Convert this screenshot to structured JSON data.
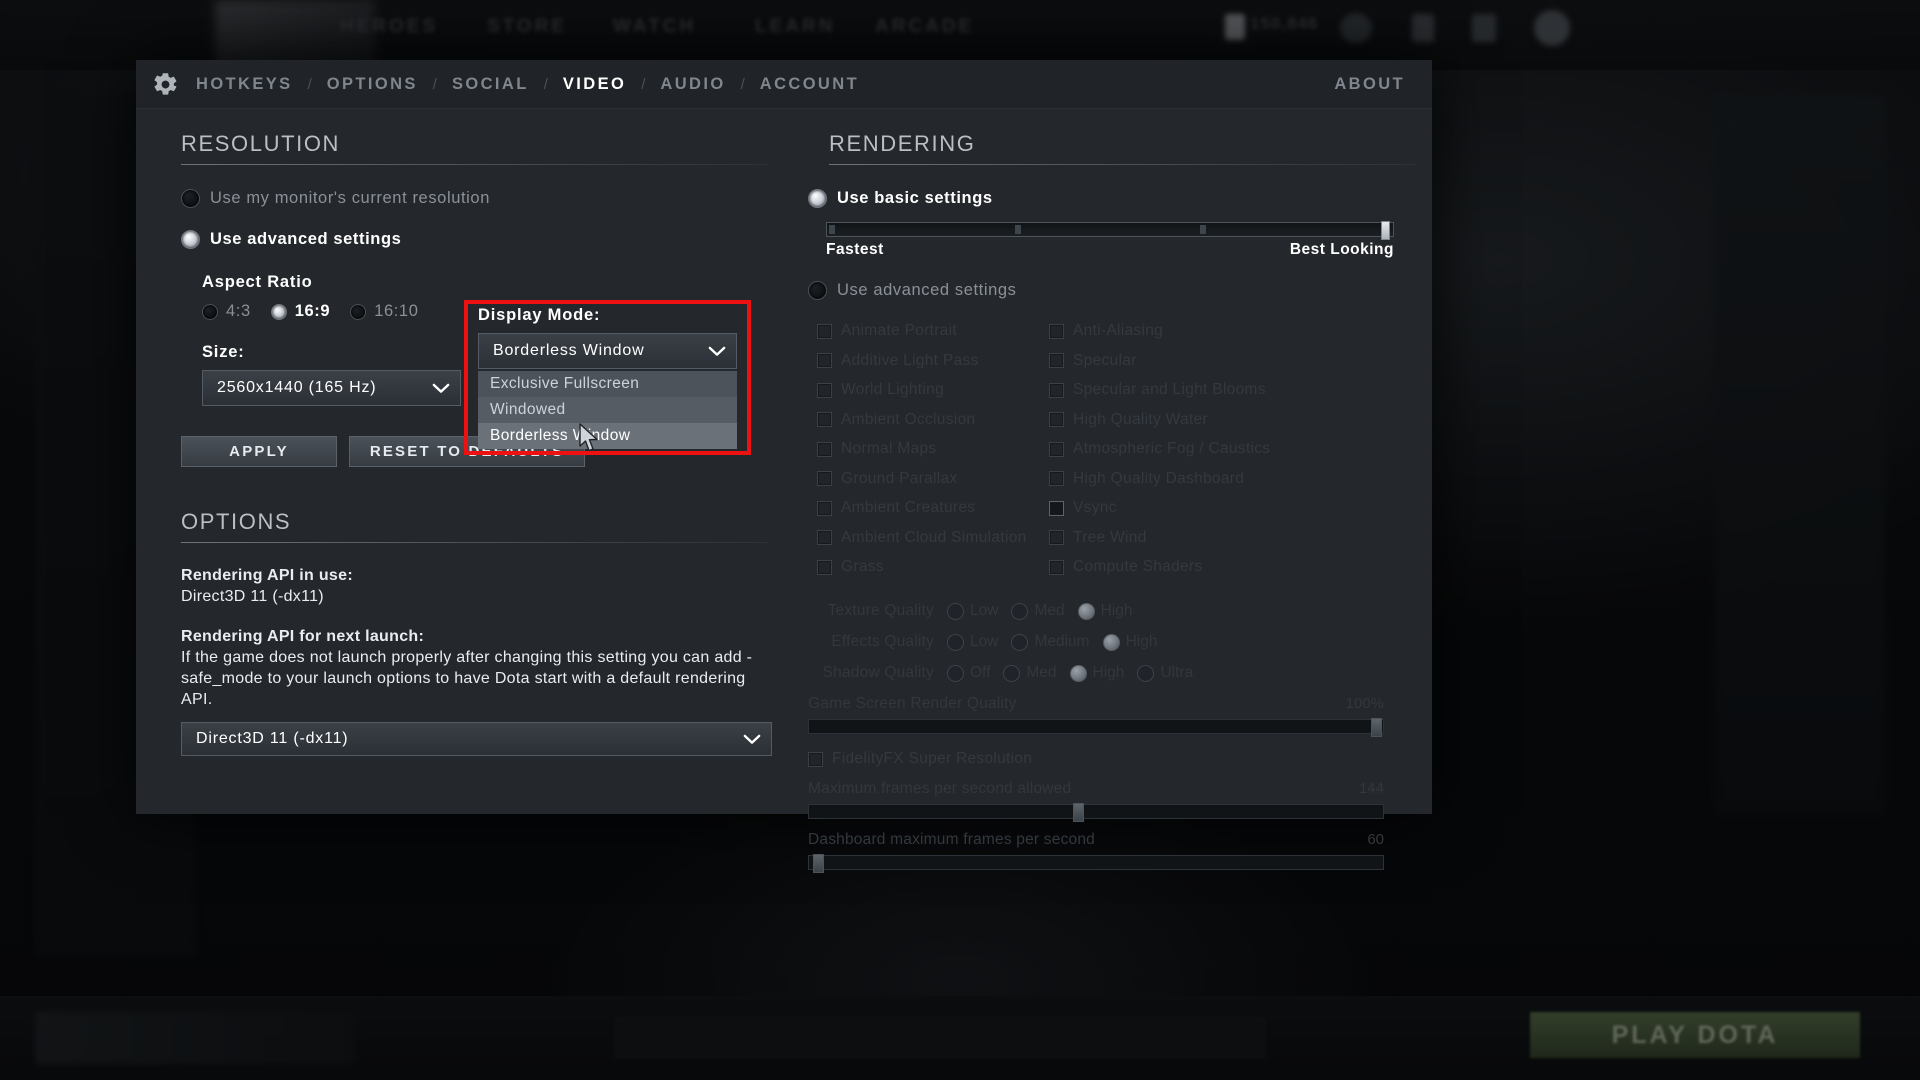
{
  "backdrop": {
    "nav_items": [
      "HEROES",
      "STORE",
      "WATCH",
      "LEARN",
      "ARCADE"
    ],
    "currency": "150,846",
    "play_button": "PLAY DOTA"
  },
  "dialog": {
    "tabs": [
      {
        "id": "hotkeys",
        "label": "HOTKEYS",
        "active": false
      },
      {
        "id": "options",
        "label": "OPTIONS",
        "active": false
      },
      {
        "id": "social",
        "label": "SOCIAL",
        "active": false
      },
      {
        "id": "video",
        "label": "VIDEO",
        "active": true
      },
      {
        "id": "audio",
        "label": "AUDIO",
        "active": false
      },
      {
        "id": "account",
        "label": "ACCOUNT",
        "active": false
      }
    ],
    "tab_separator": "/",
    "about_label": "ABOUT",
    "gear_icon": "gear-icon"
  },
  "resolution": {
    "heading": "RESOLUTION",
    "use_monitor_resolution": {
      "label": "Use my monitor's current resolution",
      "selected": false
    },
    "use_advanced_settings": {
      "label": "Use advanced settings",
      "selected": true
    },
    "aspect_ratio": {
      "label": "Aspect Ratio",
      "options": [
        {
          "label": "4:3",
          "selected": false
        },
        {
          "label": "16:9",
          "selected": true
        },
        {
          "label": "16:10",
          "selected": false
        }
      ]
    },
    "size": {
      "label": "Size:",
      "value": "2560x1440 (165 Hz)",
      "chevron": "chevron-down-icon"
    },
    "display_mode": {
      "label": "Display Mode:",
      "value": "Borderless Window",
      "chevron": "chevron-down-icon",
      "options": [
        {
          "label": "Exclusive Fullscreen",
          "hovered": false
        },
        {
          "label": "Windowed",
          "hovered": false
        },
        {
          "label": "Borderless Window",
          "hovered": true
        }
      ]
    },
    "apply_button": "APPLY",
    "reset_button": "RESET TO DEFAULTS"
  },
  "options": {
    "heading": "OPTIONS",
    "api_in_use_label": "Rendering API in use:",
    "api_in_use_value": "Direct3D 11 (-dx11)",
    "api_next_label": "Rendering API for next launch:",
    "api_next_note": "If the game does not launch properly after changing this setting you can add -safe_mode to your launch options to have Dota start with a default rendering API.",
    "api_select_value": "Direct3D 11 (-dx11)",
    "chevron": "chevron-down-icon"
  },
  "rendering": {
    "heading": "RENDERING",
    "use_basic_settings": {
      "label": "Use basic settings",
      "selected": true
    },
    "use_advanced_settings": {
      "label": "Use advanced settings",
      "selected": false
    },
    "quality_slider": {
      "min_label": "Fastest",
      "max_label": "Best Looking",
      "value_percent": 100,
      "notch_percents": [
        0,
        33.5,
        66.5,
        100
      ]
    },
    "checkboxes_left": [
      {
        "label": "Animate Portrait",
        "checked": false
      },
      {
        "label": "Additive Light Pass",
        "checked": false
      },
      {
        "label": "World Lighting",
        "checked": false
      },
      {
        "label": "Ambient Occlusion",
        "checked": false
      },
      {
        "label": "Normal Maps",
        "checked": false
      },
      {
        "label": "Ground Parallax",
        "checked": false
      },
      {
        "label": "Ambient Creatures",
        "checked": false
      },
      {
        "label": "Ambient Cloud Simulation",
        "checked": false
      },
      {
        "label": "Grass",
        "checked": false
      }
    ],
    "checkboxes_right": [
      {
        "label": "Anti-Aliasing",
        "checked": false
      },
      {
        "label": "Specular",
        "checked": false
      },
      {
        "label": "Specular and Light Blooms",
        "checked": false
      },
      {
        "label": "High Quality Water",
        "checked": false
      },
      {
        "label": "Atmospheric Fog / Caustics",
        "checked": false
      },
      {
        "label": "High Quality Dashboard",
        "checked": false
      },
      {
        "label": "Vsync",
        "checked": false
      },
      {
        "label": "Tree Wind",
        "checked": false
      },
      {
        "label": "Compute Shaders",
        "checked": false
      }
    ],
    "quality_rows": [
      {
        "name": "Texture Quality",
        "options": [
          {
            "label": "Low",
            "selected": false
          },
          {
            "label": "Med",
            "selected": false
          },
          {
            "label": "High",
            "selected": true
          }
        ]
      },
      {
        "name": "Effects Quality",
        "options": [
          {
            "label": "Low",
            "selected": false
          },
          {
            "label": "Medium",
            "selected": false
          },
          {
            "label": "High",
            "selected": true
          }
        ]
      },
      {
        "name": "Shadow Quality",
        "options": [
          {
            "label": "Off",
            "selected": false
          },
          {
            "label": "Med",
            "selected": false
          },
          {
            "label": "High",
            "selected": true
          },
          {
            "label": "Ultra",
            "selected": false
          }
        ]
      }
    ],
    "game_screen_render_quality": {
      "label": "Game Screen Render Quality",
      "value": "100%",
      "percent": 100
    },
    "fidelityfx": {
      "label": "FidelityFX Super Resolution",
      "checked": false
    },
    "max_fps": {
      "label": "Maximum frames per second allowed",
      "value": "144",
      "percent": 47
    },
    "dashboard_fps": {
      "label": "Dashboard maximum frames per second",
      "value": "60",
      "percent": 1
    }
  },
  "colors": {
    "highlight_box": "#ee1111",
    "panel_bg": "#24272b",
    "accent_text": "#ffffff"
  }
}
